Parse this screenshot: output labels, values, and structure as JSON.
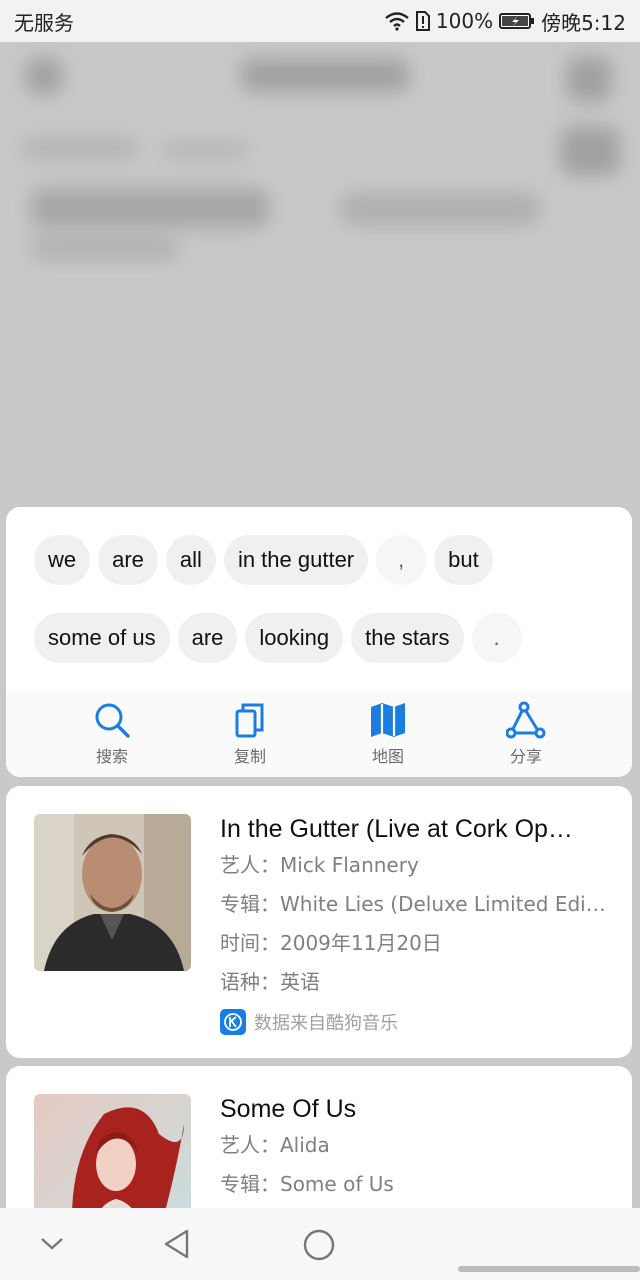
{
  "status_bar": {
    "carrier": "无服务",
    "battery_percent": "100%",
    "time": "傍晚5:12"
  },
  "segments": {
    "row1": [
      {
        "text": "we",
        "punct": false
      },
      {
        "text": "are",
        "punct": false
      },
      {
        "text": "all",
        "punct": false
      },
      {
        "text": "in the gutter",
        "punct": false
      },
      {
        "text": ",",
        "punct": true
      },
      {
        "text": "but",
        "punct": false
      }
    ],
    "row2": [
      {
        "text": "some of us",
        "punct": false
      },
      {
        "text": "are",
        "punct": false
      },
      {
        "text": "looking",
        "punct": false
      },
      {
        "text": "the stars",
        "punct": false
      },
      {
        "text": ".",
        "punct": true
      }
    ]
  },
  "actions": [
    {
      "label": "搜索",
      "icon": "search-icon"
    },
    {
      "label": "复制",
      "icon": "copy-icon"
    },
    {
      "label": "地图",
      "icon": "map-icon"
    },
    {
      "label": "分享",
      "icon": "share-icon"
    }
  ],
  "songs": [
    {
      "title": "In the Gutter (Live at Cork Op…",
      "artist_label": "艺人：",
      "artist": "Mick Flannery",
      "album_label": "专辑：",
      "album": "White Lies (Deluxe Limited Editi…",
      "date_label": "时间：",
      "date": "2009年11月20日",
      "language_label": "语种：",
      "language": "英语",
      "source": "数据来自酷狗音乐"
    },
    {
      "title": "Some Of Us",
      "artist_label": "艺人：",
      "artist": "Alida",
      "album_label": "专辑：",
      "album": "Some of Us"
    }
  ],
  "colors": {
    "accent": "#1a7ee0",
    "chip_bg": "#f0f0f0",
    "dim_overlay": "#c9c9c9"
  }
}
